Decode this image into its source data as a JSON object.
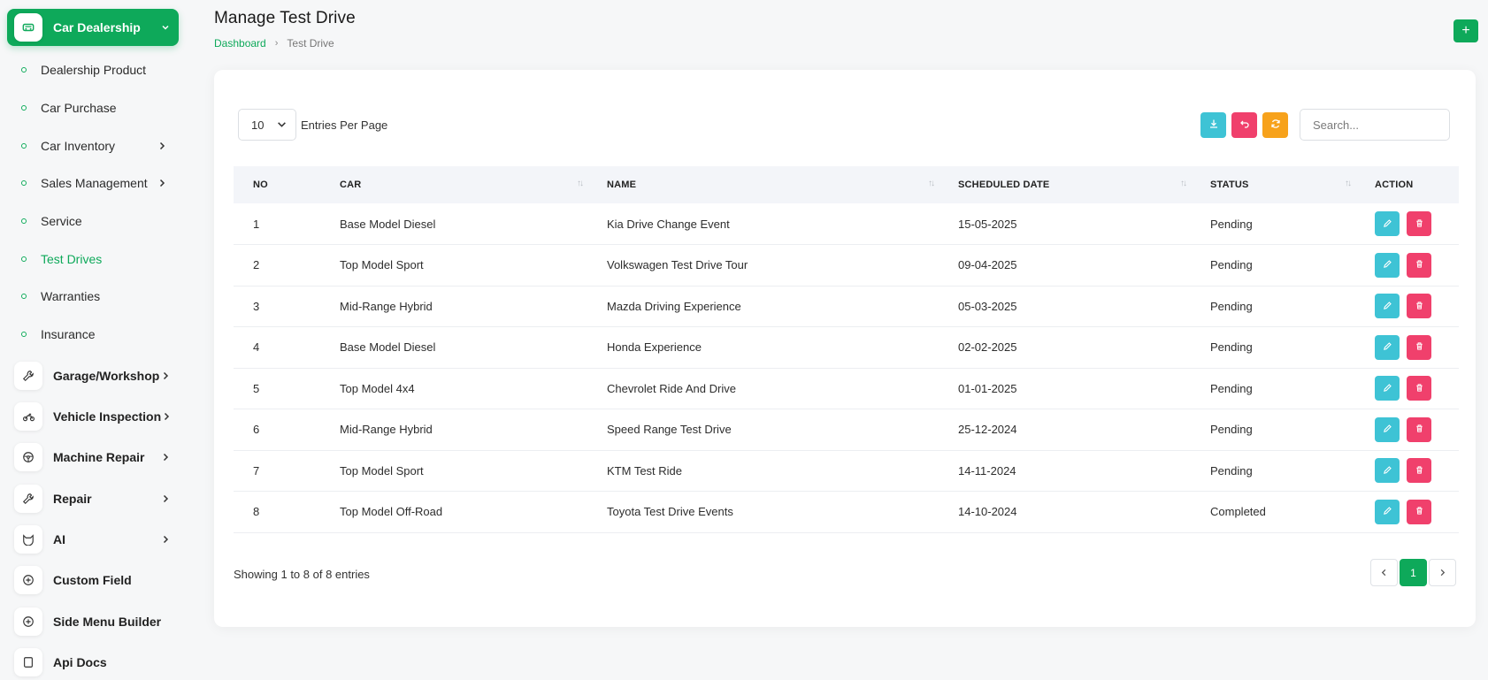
{
  "sidebar": {
    "active_group": {
      "label": "Car Dealership",
      "icon": "car-icon"
    },
    "sub_items": [
      {
        "label": "Dealership Product",
        "has_children": false,
        "active": false
      },
      {
        "label": "Car Purchase",
        "has_children": false,
        "active": false
      },
      {
        "label": "Car Inventory",
        "has_children": true,
        "active": false
      },
      {
        "label": "Sales Management",
        "has_children": true,
        "active": false
      },
      {
        "label": "Service",
        "has_children": false,
        "active": false
      },
      {
        "label": "Test Drives",
        "has_children": false,
        "active": true
      },
      {
        "label": "Warranties",
        "has_children": false,
        "active": false
      },
      {
        "label": "Insurance",
        "has_children": false,
        "active": false
      }
    ],
    "groups": [
      {
        "label": "Garage/Workshop",
        "icon": "wrench-icon"
      },
      {
        "label": "Vehicle Inspection",
        "icon": "motorbike-icon"
      },
      {
        "label": "Machine Repair",
        "icon": "steering-wheel-icon"
      },
      {
        "label": "Repair",
        "icon": "wrench-icon"
      },
      {
        "label": "AI",
        "icon": "ai-icon"
      },
      {
        "label": "Custom Field",
        "icon": "plus-circle-icon"
      },
      {
        "label": "Side Menu Builder",
        "icon": "plus-circle-icon"
      },
      {
        "label": "Api Docs",
        "icon": "doc-icon"
      }
    ]
  },
  "header": {
    "title": "Manage Test Drive",
    "breadcrumb": {
      "home": "Dashboard",
      "current": "Test Drive"
    },
    "add_label": "+"
  },
  "toolbar": {
    "entries_value": "10",
    "entries_label": "Entries Per Page",
    "search_placeholder": "Search...",
    "colors": {
      "download": "#3ec3d5",
      "reset": "#f0406c",
      "refresh": "#f7a21b"
    }
  },
  "table": {
    "columns": [
      "NO",
      "CAR",
      "NAME",
      "SCHEDULED DATE",
      "STATUS",
      "ACTION"
    ],
    "rows": [
      {
        "no": "1",
        "car": "Base Model Diesel",
        "name": "Kia Drive Change Event",
        "date": "15-05-2025",
        "status": "Pending"
      },
      {
        "no": "2",
        "car": "Top Model Sport",
        "name": "Volkswagen Test Drive Tour",
        "date": "09-04-2025",
        "status": "Pending"
      },
      {
        "no": "3",
        "car": "Mid-Range Hybrid",
        "name": "Mazda Driving Experience",
        "date": "05-03-2025",
        "status": "Pending"
      },
      {
        "no": "4",
        "car": "Base Model Diesel",
        "name": "Honda Experience",
        "date": "02-02-2025",
        "status": "Pending"
      },
      {
        "no": "5",
        "car": "Top Model 4x4",
        "name": "Chevrolet Ride And Drive",
        "date": "01-01-2025",
        "status": "Pending"
      },
      {
        "no": "6",
        "car": "Mid-Range Hybrid",
        "name": "Speed Range Test Drive",
        "date": "25-12-2024",
        "status": "Pending"
      },
      {
        "no": "7",
        "car": "Top Model Sport",
        "name": "KTM Test Ride",
        "date": "14-11-2024",
        "status": "Pending"
      },
      {
        "no": "8",
        "car": "Top Model Off-Road",
        "name": "Toyota Test Drive Events",
        "date": "14-10-2024",
        "status": "Completed"
      }
    ]
  },
  "footer": {
    "showing": "Showing 1 to 8 of 8 entries",
    "current_page": "1"
  },
  "colors": {
    "accent": "#0ea95a",
    "edit": "#3ec3d5",
    "delete": "#f0406c"
  }
}
